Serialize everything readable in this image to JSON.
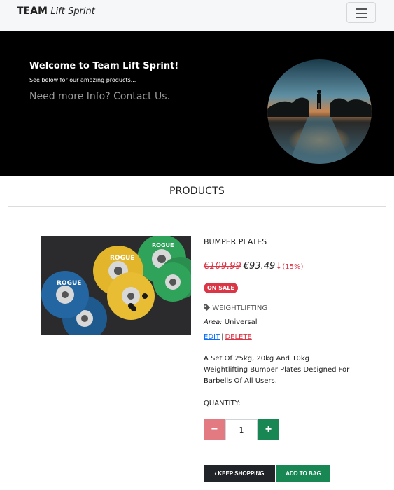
{
  "navbar": {
    "brand_team": "TEAM",
    "brand_name": "Lift Sprint",
    "menu_icon": "hamburger-icon"
  },
  "hero": {
    "title": "Welcome to Team Lift Sprint!",
    "subtitle": "See below for our amazing products...",
    "contact": "Need more Info? Contact Us."
  },
  "products": {
    "heading": "PRODUCTS"
  },
  "product": {
    "name": "BUMPER PLATES",
    "old_price": "€109.99",
    "new_price": "€93.49",
    "discount": "(15%)",
    "badge": "ON SALE",
    "category": "WEIGHTLIFTING",
    "area_label": "Area:",
    "area_value": "Universal",
    "edit": "EDIT",
    "separator": "|",
    "delete": "DELETE",
    "description": "A Set Of 25kg, 20kg And 10kg Weightlifting Bumper Plates Designed For Barbells Of All Users.",
    "plate_text": "ROGUE"
  },
  "quantity": {
    "label": "QUANTITY:",
    "value": "1",
    "minus": "−",
    "plus": "+"
  },
  "buttons": {
    "keep_shopping": "KEEP SHOPPING",
    "add_to_bag": "ADD TO BAG"
  },
  "colors": {
    "sale_red": "#dc3545",
    "success_green": "#198754",
    "dark": "#212529"
  }
}
